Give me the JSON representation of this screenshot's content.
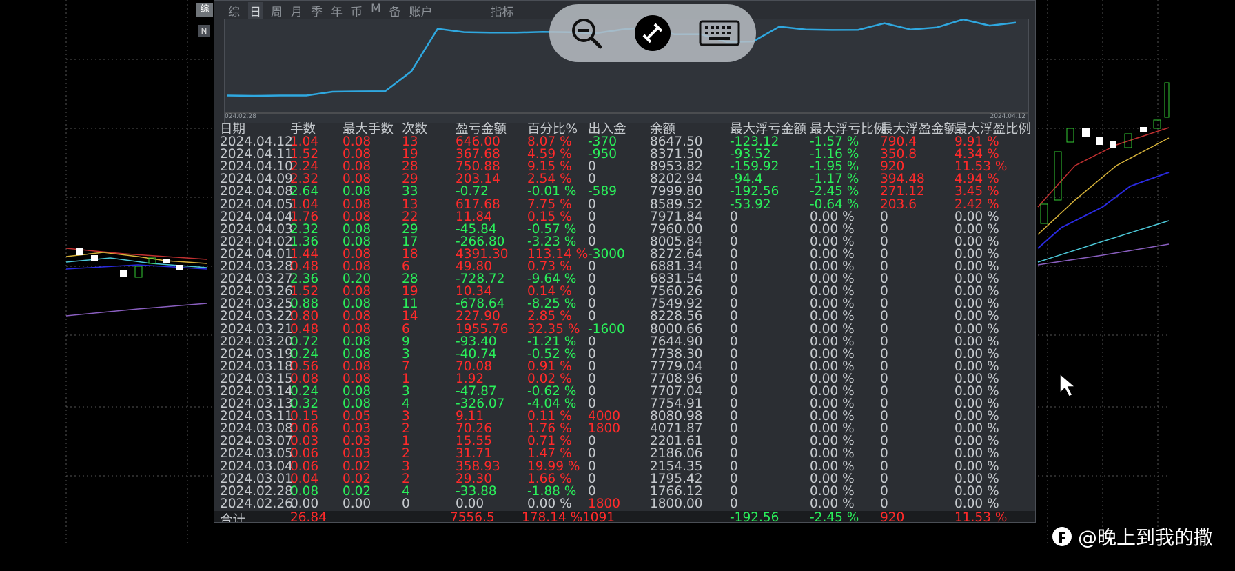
{
  "toolbar_tabs": [
    "综",
    "日",
    "周",
    "月",
    "季",
    "年",
    "币",
    "M",
    "备",
    "账户",
    "",
    "指标"
  ],
  "side_tag": "综",
  "side_tag2": "N",
  "curve": {
    "start_label": "024.02.28",
    "end_label": "2024.04.12",
    "line_color": "#2fa8e0",
    "values": [
      1800,
      1766,
      1795,
      1796,
      2154,
      2186,
      2202,
      4072,
      8081,
      7755,
      7707,
      7709,
      7779,
      7738,
      7645,
      8001,
      8229,
      7550,
      7560,
      6832,
      6881,
      8273,
      8006,
      7960,
      7972,
      8590,
      8000,
      8203,
      8954,
      8372,
      8648
    ]
  },
  "table": {
    "headers": [
      "日期",
      "手数",
      "最大手数",
      "次数",
      "盈亏金额",
      "百分比%",
      "出入金",
      "余额",
      "最大浮亏金额",
      "最大浮亏比例",
      "最大浮盈金额",
      "最大浮盈比例"
    ],
    "rows": [
      {
        "date": "2024.04.12",
        "lots": "1.04",
        "max": "0.08",
        "cnt": "13",
        "pnl": "646.00",
        "pct": "8.07 %",
        "io": "-370",
        "bal": "8647.50",
        "mfl": "-123.12",
        "mflp": "-1.57 %",
        "mfp": "790.4",
        "mfpp": "9.91 %",
        "s": "up",
        "ios": "dn",
        "fs": "col"
      },
      {
        "date": "2024.04.11",
        "lots": "1.52",
        "max": "0.08",
        "cnt": "19",
        "pnl": "367.68",
        "pct": "4.59 %",
        "io": "-950",
        "bal": "8371.50",
        "mfl": "-93.52",
        "mflp": "-1.16 %",
        "mfp": "350.8",
        "mfpp": "4.34 %",
        "s": "up",
        "ios": "dn",
        "fs": "col"
      },
      {
        "date": "2024.04.10",
        "lots": "2.24",
        "max": "0.08",
        "cnt": "28",
        "pnl": "750.88",
        "pct": "9.15 %",
        "io": "0",
        "bal": "8953.82",
        "mfl": "-159.92",
        "mflp": "-1.95 %",
        "mfp": "920",
        "mfpp": "11.53 %",
        "s": "up",
        "ios": "nu",
        "fs": "col"
      },
      {
        "date": "2024.04.09",
        "lots": "2.32",
        "max": "0.08",
        "cnt": "29",
        "pnl": "203.14",
        "pct": "2.54 %",
        "io": "0",
        "bal": "8202.94",
        "mfl": "-94.4",
        "mflp": "-1.17 %",
        "mfp": "394.48",
        "mfpp": "4.94 %",
        "s": "up",
        "ios": "nu",
        "fs": "col"
      },
      {
        "date": "2024.04.08",
        "lots": "2.64",
        "max": "0.08",
        "cnt": "33",
        "pnl": "-0.72",
        "pct": "-0.01 %",
        "io": "-589",
        "bal": "7999.80",
        "mfl": "-192.56",
        "mflp": "-2.45 %",
        "mfp": "271.12",
        "mfpp": "3.45 %",
        "s": "dn",
        "ios": "dn",
        "fs": "col"
      },
      {
        "date": "2024.04.05",
        "lots": "1.04",
        "max": "0.08",
        "cnt": "13",
        "pnl": "617.68",
        "pct": "7.75 %",
        "io": "0",
        "bal": "8589.52",
        "mfl": "-53.92",
        "mflp": "-0.64 %",
        "mfp": "203.6",
        "mfpp": "2.42 %",
        "s": "up",
        "ios": "nu",
        "fs": "col"
      },
      {
        "date": "2024.04.04",
        "lots": "1.76",
        "max": "0.08",
        "cnt": "22",
        "pnl": "11.84",
        "pct": "0.15 %",
        "io": "0",
        "bal": "7971.84",
        "mfl": "0",
        "mflp": "0.00 %",
        "mfp": "0",
        "mfpp": "0.00 %",
        "s": "up",
        "ios": "nu",
        "fs": "nu"
      },
      {
        "date": "2024.04.03",
        "lots": "2.32",
        "max": "0.08",
        "cnt": "29",
        "pnl": "-45.84",
        "pct": "-0.57 %",
        "io": "0",
        "bal": "7960.00",
        "mfl": "0",
        "mflp": "0.00 %",
        "mfp": "0",
        "mfpp": "0.00 %",
        "s": "dn",
        "ios": "nu",
        "fs": "nu"
      },
      {
        "date": "2024.04.02",
        "lots": "1.36",
        "max": "0.08",
        "cnt": "17",
        "pnl": "-266.80",
        "pct": "-3.23 %",
        "io": "0",
        "bal": "8005.84",
        "mfl": "0",
        "mflp": "0.00 %",
        "mfp": "0",
        "mfpp": "0.00 %",
        "s": "dn",
        "ios": "nu",
        "fs": "nu"
      },
      {
        "date": "2024.04.01",
        "lots": "1.44",
        "max": "0.08",
        "cnt": "18",
        "pnl": "4391.30",
        "pct": "113.14 %",
        "io": "-3000",
        "bal": "8272.64",
        "mfl": "0",
        "mflp": "0.00 %",
        "mfp": "0",
        "mfpp": "0.00 %",
        "s": "up",
        "ios": "dn",
        "fs": "nu"
      },
      {
        "date": "2024.03.28",
        "lots": "0.48",
        "max": "0.08",
        "cnt": "6",
        "pnl": "49.80",
        "pct": "0.73 %",
        "io": "0",
        "bal": "6881.34",
        "mfl": "0",
        "mflp": "0.00 %",
        "mfp": "0",
        "mfpp": "0.00 %",
        "s": "up",
        "ios": "nu",
        "fs": "nu"
      },
      {
        "date": "2024.03.27",
        "lots": "2.36",
        "max": "0.20",
        "cnt": "28",
        "pnl": "-728.72",
        "pct": "-9.64 %",
        "io": "0",
        "bal": "6831.54",
        "mfl": "0",
        "mflp": "0.00 %",
        "mfp": "0",
        "mfpp": "0.00 %",
        "s": "dn",
        "ios": "nu",
        "fs": "nu"
      },
      {
        "date": "2024.03.26",
        "lots": "1.52",
        "max": "0.08",
        "cnt": "19",
        "pnl": "10.34",
        "pct": "0.14 %",
        "io": "0",
        "bal": "7560.26",
        "mfl": "0",
        "mflp": "0.00 %",
        "mfp": "0",
        "mfpp": "0.00 %",
        "s": "up",
        "ios": "nu",
        "fs": "nu"
      },
      {
        "date": "2024.03.25",
        "lots": "0.88",
        "max": "0.08",
        "cnt": "11",
        "pnl": "-678.64",
        "pct": "-8.25 %",
        "io": "0",
        "bal": "7549.92",
        "mfl": "0",
        "mflp": "0.00 %",
        "mfp": "0",
        "mfpp": "0.00 %",
        "s": "dn",
        "ios": "nu",
        "fs": "nu"
      },
      {
        "date": "2024.03.22",
        "lots": "0.80",
        "max": "0.08",
        "cnt": "14",
        "pnl": "227.90",
        "pct": "2.85 %",
        "io": "0",
        "bal": "8228.56",
        "mfl": "0",
        "mflp": "0.00 %",
        "mfp": "0",
        "mfpp": "0.00 %",
        "s": "up",
        "ios": "nu",
        "fs": "nu"
      },
      {
        "date": "2024.03.21",
        "lots": "0.48",
        "max": "0.08",
        "cnt": "6",
        "pnl": "1955.76",
        "pct": "32.35 %",
        "io": "-1600",
        "bal": "8000.66",
        "mfl": "0",
        "mflp": "0.00 %",
        "mfp": "0",
        "mfpp": "0.00 %",
        "s": "up",
        "ios": "dn",
        "fs": "nu"
      },
      {
        "date": "2024.03.20",
        "lots": "0.72",
        "max": "0.08",
        "cnt": "9",
        "pnl": "-93.40",
        "pct": "-1.21 %",
        "io": "0",
        "bal": "7644.90",
        "mfl": "0",
        "mflp": "0.00 %",
        "mfp": "0",
        "mfpp": "0.00 %",
        "s": "dn",
        "ios": "nu",
        "fs": "nu"
      },
      {
        "date": "2024.03.19",
        "lots": "0.24",
        "max": "0.08",
        "cnt": "3",
        "pnl": "-40.74",
        "pct": "-0.52 %",
        "io": "0",
        "bal": "7738.30",
        "mfl": "0",
        "mflp": "0.00 %",
        "mfp": "0",
        "mfpp": "0.00 %",
        "s": "dn",
        "ios": "nu",
        "fs": "nu"
      },
      {
        "date": "2024.03.18",
        "lots": "0.56",
        "max": "0.08",
        "cnt": "7",
        "pnl": "70.08",
        "pct": "0.91 %",
        "io": "0",
        "bal": "7779.04",
        "mfl": "0",
        "mflp": "0.00 %",
        "mfp": "0",
        "mfpp": "0.00 %",
        "s": "up",
        "ios": "nu",
        "fs": "nu"
      },
      {
        "date": "2024.03.15",
        "lots": "0.08",
        "max": "0.08",
        "cnt": "1",
        "pnl": "1.92",
        "pct": "0.02 %",
        "io": "0",
        "bal": "7708.96",
        "mfl": "0",
        "mflp": "0.00 %",
        "mfp": "0",
        "mfpp": "0.00 %",
        "s": "up",
        "ios": "nu",
        "fs": "nu"
      },
      {
        "date": "2024.03.14",
        "lots": "0.24",
        "max": "0.08",
        "cnt": "3",
        "pnl": "-47.87",
        "pct": "-0.62 %",
        "io": "0",
        "bal": "7707.04",
        "mfl": "0",
        "mflp": "0.00 %",
        "mfp": "0",
        "mfpp": "0.00 %",
        "s": "dn",
        "ios": "nu",
        "fs": "nu"
      },
      {
        "date": "2024.03.13",
        "lots": "0.32",
        "max": "0.08",
        "cnt": "4",
        "pnl": "-326.07",
        "pct": "-4.04 %",
        "io": "0",
        "bal": "7754.91",
        "mfl": "0",
        "mflp": "0.00 %",
        "mfp": "0",
        "mfpp": "0.00 %",
        "s": "dn",
        "ios": "nu",
        "fs": "nu"
      },
      {
        "date": "2024.03.11",
        "lots": "0.15",
        "max": "0.05",
        "cnt": "3",
        "pnl": "9.11",
        "pct": "0.11 %",
        "io": "4000",
        "bal": "8080.98",
        "mfl": "0",
        "mflp": "0.00 %",
        "mfp": "0",
        "mfpp": "0.00 %",
        "s": "up",
        "ios": "up",
        "fs": "nu"
      },
      {
        "date": "2024.03.08",
        "lots": "0.06",
        "max": "0.03",
        "cnt": "2",
        "pnl": "70.26",
        "pct": "1.76 %",
        "io": "1800",
        "bal": "4071.87",
        "mfl": "0",
        "mflp": "0.00 %",
        "mfp": "0",
        "mfpp": "0.00 %",
        "s": "up",
        "ios": "up",
        "fs": "nu"
      },
      {
        "date": "2024.03.07",
        "lots": "0.03",
        "max": "0.03",
        "cnt": "1",
        "pnl": "15.55",
        "pct": "0.71 %",
        "io": "0",
        "bal": "2201.61",
        "mfl": "0",
        "mflp": "0.00 %",
        "mfp": "0",
        "mfpp": "0.00 %",
        "s": "up",
        "ios": "nu",
        "fs": "nu"
      },
      {
        "date": "2024.03.05",
        "lots": "0.06",
        "max": "0.03",
        "cnt": "2",
        "pnl": "31.71",
        "pct": "1.47 %",
        "io": "0",
        "bal": "2186.06",
        "mfl": "0",
        "mflp": "0.00 %",
        "mfp": "0",
        "mfpp": "0.00 %",
        "s": "up",
        "ios": "nu",
        "fs": "nu"
      },
      {
        "date": "2024.03.04",
        "lots": "0.06",
        "max": "0.02",
        "cnt": "3",
        "pnl": "358.93",
        "pct": "19.99 %",
        "io": "0",
        "bal": "2154.35",
        "mfl": "0",
        "mflp": "0.00 %",
        "mfp": "0",
        "mfpp": "0.00 %",
        "s": "up",
        "ios": "nu",
        "fs": "nu"
      },
      {
        "date": "2024.03.01",
        "lots": "0.04",
        "max": "0.02",
        "cnt": "2",
        "pnl": "29.30",
        "pct": "1.66 %",
        "io": "0",
        "bal": "1795.42",
        "mfl": "0",
        "mflp": "0.00 %",
        "mfp": "0",
        "mfpp": "0.00 %",
        "s": "up",
        "ios": "nu",
        "fs": "nu"
      },
      {
        "date": "2024.02.28",
        "lots": "0.08",
        "max": "0.02",
        "cnt": "4",
        "pnl": "-33.88",
        "pct": "-1.88 %",
        "io": "0",
        "bal": "1766.12",
        "mfl": "0",
        "mflp": "0.00 %",
        "mfp": "0",
        "mfpp": "0.00 %",
        "s": "dn",
        "ios": "nu",
        "fs": "nu"
      },
      {
        "date": "2024.02.26",
        "lots": "0.00",
        "max": "0.00",
        "cnt": "0",
        "pnl": "0.00",
        "pct": "0.00 %",
        "io": "1800",
        "bal": "1800.00",
        "mfl": "0",
        "mflp": "0.00 %",
        "mfp": "0",
        "mfpp": "0.00 %",
        "s": "nu",
        "ios": "up",
        "fs": "nu"
      }
    ]
  },
  "total": {
    "label": "合计",
    "lots": "26.84",
    "pnl": "7556.5",
    "pct": "178.14 %",
    "io": "1091",
    "mfl": "-192.56",
    "mflp": "-2.45 %",
    "mfp": "920",
    "mfpp": "11.53 %"
  },
  "toolbar": {
    "zoom": "zoom-out-icon",
    "connect": "remote-connect-icon",
    "keyboard": "keyboard-icon"
  },
  "watermark": {
    "text": "@晚上到我的撒"
  },
  "colors": {
    "up": "#ff2a2a",
    "down": "#2aef5a",
    "neutral": "#c5c9cd",
    "panel": "#2b2e33"
  }
}
